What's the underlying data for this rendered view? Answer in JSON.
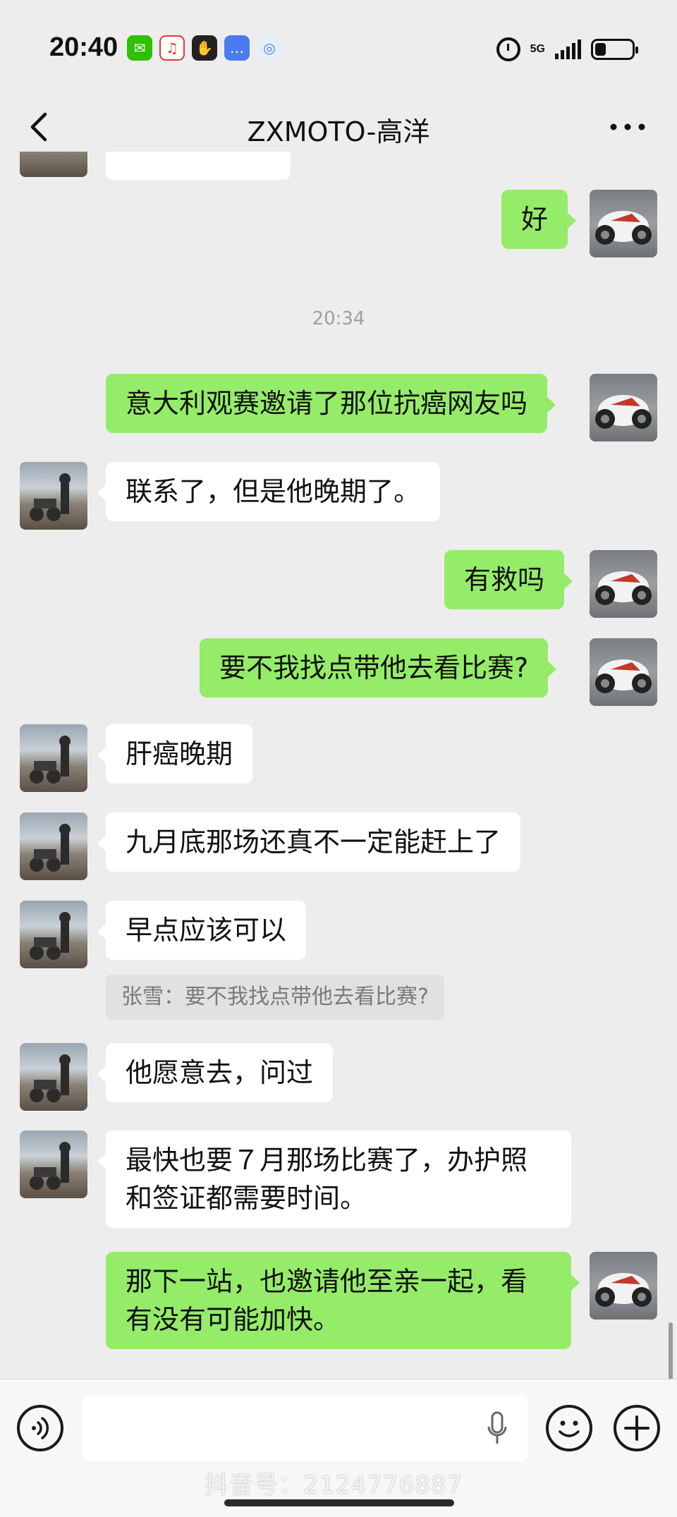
{
  "status_bar": {
    "time": "20:40",
    "network": "5G",
    "apps": [
      "wechat-icon",
      "music-icon",
      "hand-icon",
      "chat-icon",
      "cloud-icon"
    ]
  },
  "nav": {
    "title": "ZXMOTO-高洋"
  },
  "messages": [
    {
      "side": "in",
      "text": ""
    },
    {
      "side": "out",
      "text": "好"
    },
    {
      "side": "time",
      "text": "20:34"
    },
    {
      "side": "out",
      "text": "意大利观赛邀请了那位抗癌网友吗"
    },
    {
      "side": "in",
      "text": "联系了，但是他晚期了。"
    },
    {
      "side": "out",
      "text": "有救吗"
    },
    {
      "side": "out",
      "text": "要不我找点带他去看比赛?"
    },
    {
      "side": "in",
      "text": "肝癌晚期"
    },
    {
      "side": "in",
      "text": "九月底那场还真不一定能赶上了"
    },
    {
      "side": "in",
      "text": "早点应该可以"
    },
    {
      "side": "quote",
      "text": "张雪：要不我找点带他去看比赛?"
    },
    {
      "side": "in",
      "text": "他愿意去，问过"
    },
    {
      "side": "in",
      "text": "最快也要７月那场比赛了，办护照\n和签证都需要时间。"
    },
    {
      "side": "out",
      "text": "那下一站，也邀请他至亲一起，看\n有没有可能加快。"
    }
  ],
  "input": {
    "placeholder": ""
  },
  "watermark": "抖音号：2124776887",
  "colors": {
    "background": "#ededed",
    "outgoing_bubble": "#95ec69",
    "incoming_bubble": "#ffffff"
  }
}
